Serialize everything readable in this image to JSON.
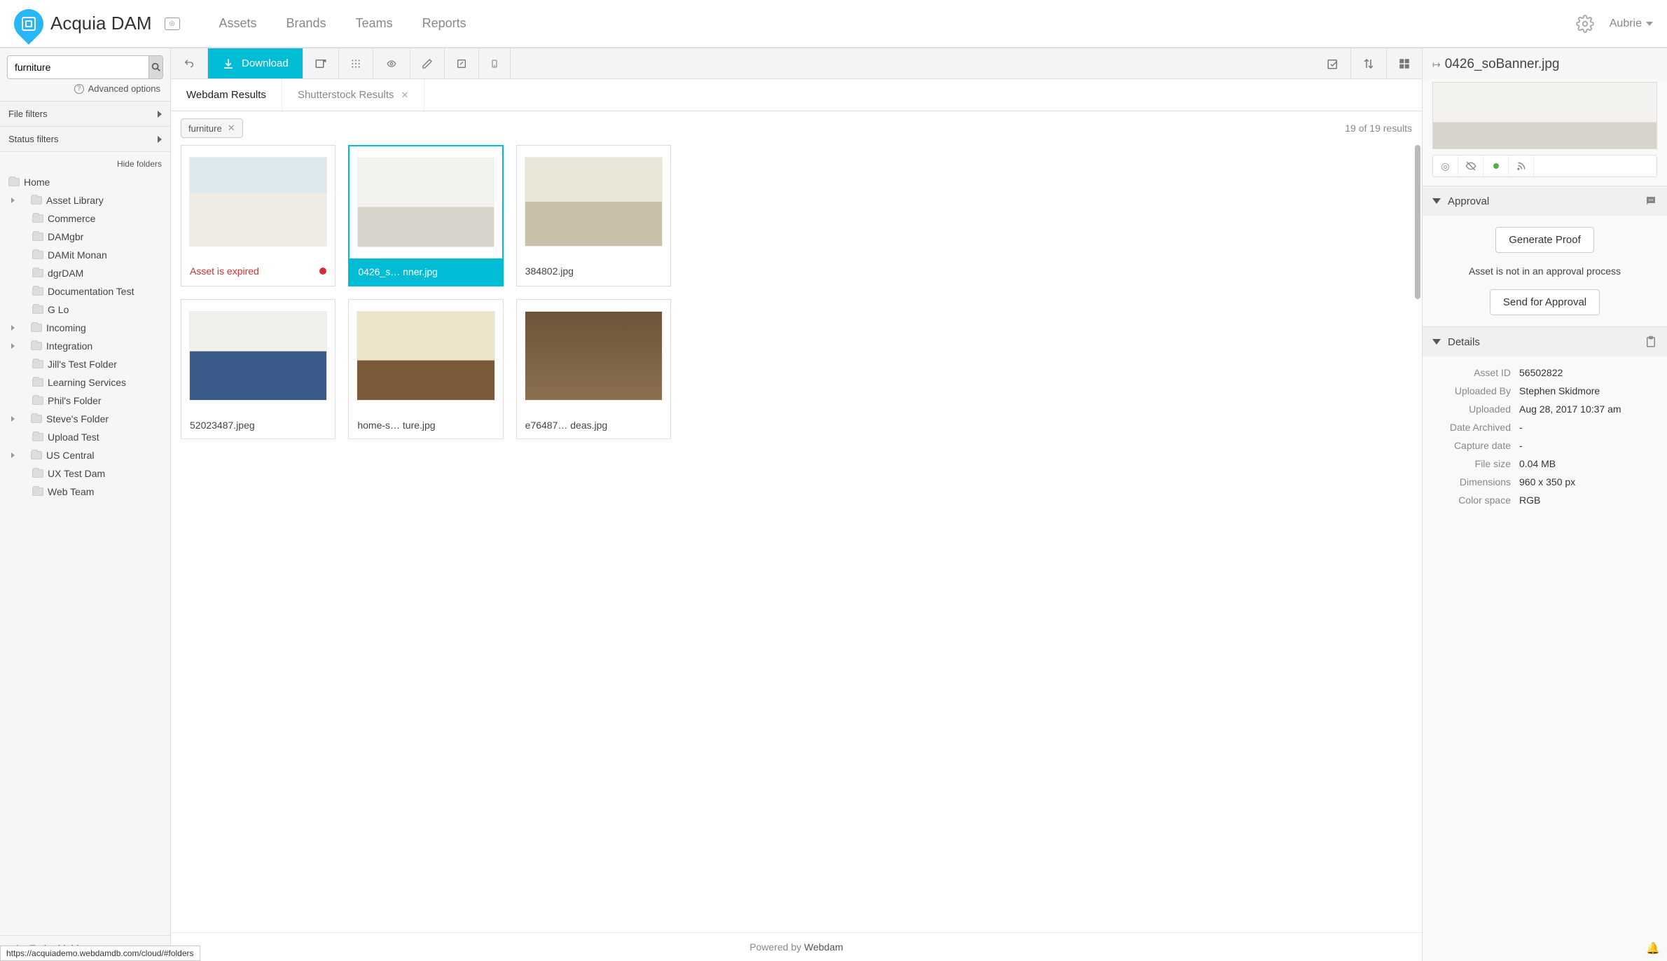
{
  "brand": "Acquia DAM",
  "nav": {
    "assets": "Assets",
    "brands": "Brands",
    "teams": "Teams",
    "reports": "Reports"
  },
  "user": {
    "name": "Aubrie"
  },
  "search": {
    "value": "furniture",
    "advanced": "Advanced options"
  },
  "filters": {
    "file": "File filters",
    "status": "Status filters",
    "hide": "Hide folders"
  },
  "tree": {
    "root": "Home",
    "items": [
      {
        "label": "Asset Library",
        "expandable": true
      },
      {
        "label": "Commerce",
        "expandable": false
      },
      {
        "label": "DAMgbr",
        "expandable": false
      },
      {
        "label": "DAMit Monan",
        "expandable": false
      },
      {
        "label": "dgrDAM",
        "expandable": false
      },
      {
        "label": "Documentation Test",
        "expandable": false
      },
      {
        "label": "G Lo",
        "expandable": false
      },
      {
        "label": "Incoming",
        "expandable": true
      },
      {
        "label": "Integration",
        "expandable": true
      },
      {
        "label": "Jill's Test Folder",
        "expandable": false
      },
      {
        "label": "Learning Services",
        "expandable": false
      },
      {
        "label": "Phil's Folder",
        "expandable": false
      },
      {
        "label": "Steve's Folder",
        "expandable": true
      },
      {
        "label": "Upload Test",
        "expandable": false
      },
      {
        "label": "US Central",
        "expandable": true
      },
      {
        "label": "UX Test Dam",
        "expandable": false
      },
      {
        "label": "Web Team",
        "expandable": false
      }
    ],
    "embeddables": "Embeddables"
  },
  "toolbar": {
    "download": "Download"
  },
  "tabs": {
    "webdam": "Webdam Results",
    "shutterstock": "Shutterstock Results"
  },
  "chips": {
    "furniture": "furniture"
  },
  "results": {
    "count": "19 of 19 results"
  },
  "cards": [
    {
      "caption": "Asset is expired",
      "expired": true,
      "scene": "scene-bedroom"
    },
    {
      "caption": "0426_s… nner.jpg",
      "selected": true,
      "scene": "scene-sectional"
    },
    {
      "caption": "384802.jpg",
      "scene": "scene-dining"
    },
    {
      "caption": "52023487.jpeg",
      "scene": "scene-bluebed"
    },
    {
      "caption": "home-s… ture.jpg",
      "scene": "scene-office"
    },
    {
      "caption": "e76487… deas.jpg",
      "scene": "scene-bunk"
    }
  ],
  "footer": {
    "prefix": "Powered by ",
    "name": "Webdam"
  },
  "asset": {
    "title": "0426_soBanner.jpg",
    "approval": {
      "heading": "Approval",
      "generate": "Generate Proof",
      "note": "Asset is not in an approval process",
      "send": "Send for Approval"
    },
    "details": {
      "heading": "Details",
      "rows": [
        {
          "label": "Asset ID",
          "value": "56502822"
        },
        {
          "label": "Uploaded By",
          "value": "Stephen Skidmore"
        },
        {
          "label": "Uploaded",
          "value": "Aug 28, 2017 10:37 am"
        },
        {
          "label": "Date Archived",
          "value": "-"
        },
        {
          "label": "Capture date",
          "value": "-"
        },
        {
          "label": "File size",
          "value": "0.04 MB"
        },
        {
          "label": "Dimensions",
          "value": "960 x 350 px"
        },
        {
          "label": "Color space",
          "value": "RGB"
        }
      ]
    }
  },
  "statusbar": "https://acquiademo.webdamdb.com/cloud/#folders"
}
